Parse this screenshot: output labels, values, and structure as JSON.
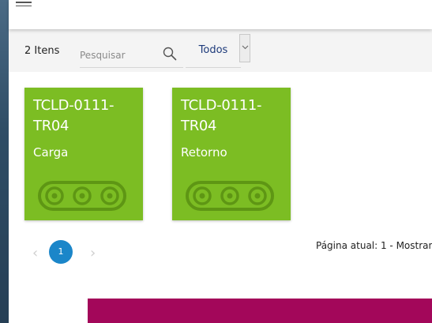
{
  "toolbar": {
    "count_label": "2 Itens",
    "search_placeholder": "Pesquisar",
    "filter_value": "Todos"
  },
  "cards": [
    {
      "title": "TCLD-0111-TR04",
      "subtitle": "Carga"
    },
    {
      "title": "TCLD-0111-TR04",
      "subtitle": "Retorno"
    }
  ],
  "pagination": {
    "prev": "‹",
    "current_page": "1",
    "next": "›",
    "status": "Página atual: 1 - Mostrand"
  },
  "colors": {
    "card": "#7cbd23",
    "page_active": "#1b86c9",
    "banner": "#a3075a",
    "filter_text": "#1d3a7a"
  },
  "icons": {
    "menu": "hamburger-icon",
    "search": "search-icon",
    "dropdown": "chevron-down-icon",
    "card": "conveyor-icon"
  }
}
